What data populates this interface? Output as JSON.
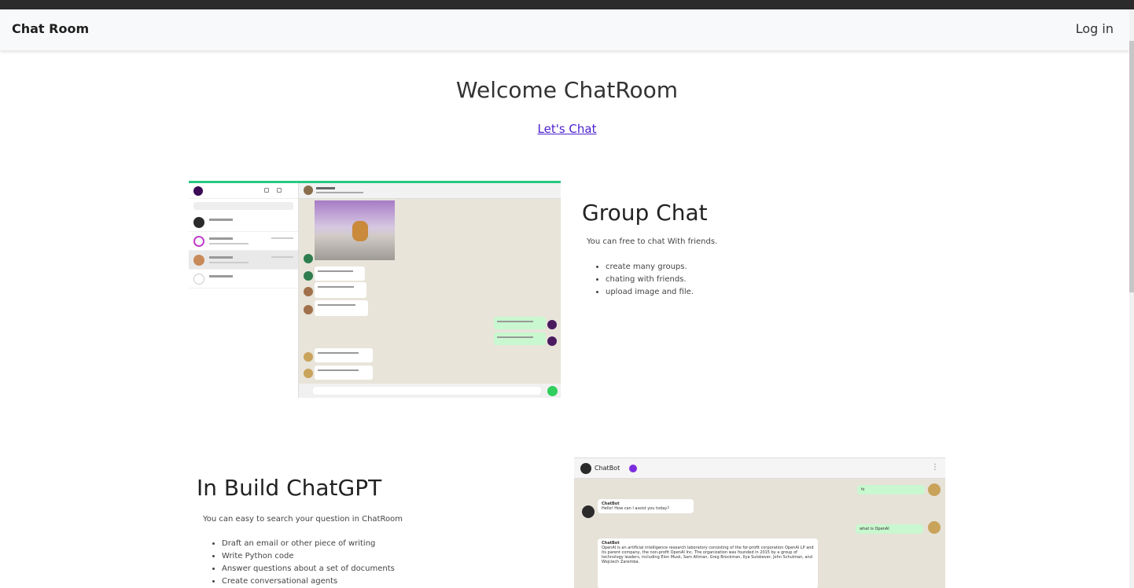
{
  "navbar": {
    "brand": "Chat Room",
    "login_label": "Log in"
  },
  "hero": {
    "title": "Welcome ChatRoom",
    "cta_label": "Let's Chat"
  },
  "group_chat": {
    "title": "Group Chat",
    "description": "You can free to chat With friends.",
    "features": [
      "create many groups.",
      "chating with friends.",
      "upload image and file."
    ]
  },
  "chatgpt": {
    "title": "In Build ChatGPT",
    "description": "You can easy to search your question in ChatRoom",
    "features": [
      "Draft an email or other piece of writing",
      "Write Python code",
      "Answer questions about a set of documents",
      "Create conversational agents"
    ],
    "preview": {
      "contact_name": "ChatBot",
      "menu_icon": "⋮",
      "messages": [
        {
          "from": "me",
          "text": "hi"
        },
        {
          "from": "bot",
          "sender": "ChatBot",
          "text": "Hello! How can I assist you today?"
        },
        {
          "from": "me",
          "text": "what is OpenAI"
        },
        {
          "from": "bot",
          "sender": "ChatBot",
          "text": "OpenAI is an artificial intelligence research laboratory consisting of the for-profit corporation OpenAI LP and its parent company, the non-profit OpenAI Inc. The organization was founded in 2015 by a group of technology leaders, including Elon Musk, Sam Altman, Greg Brockman, Ilya Sutskever, John Schulman, and Wojciech Zaremba."
        }
      ]
    }
  },
  "colors": {
    "link": "#4b1fcf",
    "accent_green": "#27c97f",
    "verified_purple": "#7c2de0",
    "chat_background": "#e8e4da",
    "my_bubble": "#c9f7cf"
  }
}
